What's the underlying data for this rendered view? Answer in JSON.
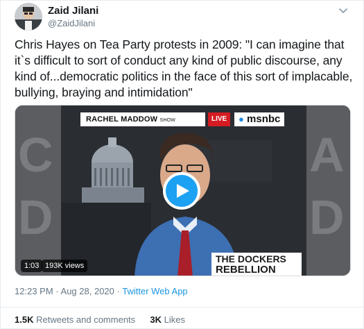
{
  "author": {
    "name": "Zaid Jilani",
    "handle": "@ZaidJilani",
    "avatar_icon": "avatar-photo"
  },
  "tweet": {
    "text": "Chris Hayes on Tea Party protests in 2009: \"I can imagine that it`s difficult to sort of conduct any kind of public discourse, any kind of...democratic politics in the face of this sort of implacable, bullying, braying and intimidation\""
  },
  "video": {
    "show_name": "RACHEL MADDOW",
    "show_suffix": "SHOW",
    "live_label": "LIVE",
    "network": "msnbc",
    "chyron_line1": "THE DOCKERS",
    "chyron_line2": "REBELLION",
    "duration": "1:03",
    "views": "193K views",
    "play_icon": "play-icon"
  },
  "meta": {
    "time": "12:23 PM",
    "separator": "·",
    "date": "Aug 28, 2020",
    "app": "Twitter Web App"
  },
  "stats": {
    "retweets_count": "1.5K",
    "retweets_label": "Retweets and comments",
    "likes_count": "3K",
    "likes_label": "Likes"
  },
  "colors": {
    "accent": "#1da1f2",
    "link": "#1b95e0",
    "muted": "#657786",
    "text": "#14171a"
  }
}
